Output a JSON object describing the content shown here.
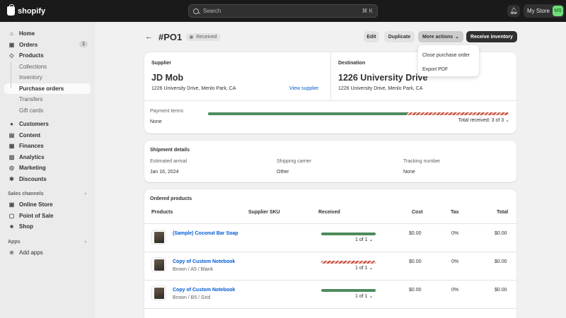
{
  "topbar": {
    "logo": "shopify",
    "search_placeholder": "Search",
    "search_shortcut": "⌘ K",
    "store_name": "My Store",
    "avatar_initials": "MS"
  },
  "sidebar": {
    "items": [
      {
        "label": "Home",
        "icon": "home-icon"
      },
      {
        "label": "Orders",
        "icon": "orders-icon",
        "badge": "1"
      },
      {
        "label": "Products",
        "icon": "tag-icon"
      }
    ],
    "product_sub": [
      "Collections",
      "Inventory",
      "Purchase orders",
      "Transfers",
      "Gift cards"
    ],
    "items2": [
      {
        "label": "Customers",
        "icon": "person-icon"
      },
      {
        "label": "Content",
        "icon": "content-icon"
      },
      {
        "label": "Finances",
        "icon": "bank-icon"
      },
      {
        "label": "Analytics",
        "icon": "chart-icon"
      },
      {
        "label": "Marketing",
        "icon": "target-icon"
      },
      {
        "label": "Discounts",
        "icon": "discount-icon"
      }
    ],
    "sales_channels_label": "Sales channels",
    "channels": [
      {
        "label": "Online Store",
        "icon": "store-icon"
      },
      {
        "label": "Point of Sale",
        "icon": "pos-icon"
      },
      {
        "label": "Shop",
        "icon": "shop-icon"
      }
    ],
    "apps_label": "Apps",
    "add_apps": "Add apps"
  },
  "header": {
    "title": "#PO1",
    "status": "Received",
    "edit": "Edit",
    "duplicate": "Duplicate",
    "more_actions": "More actions",
    "receive_inventory": "Receive inventory"
  },
  "dropdown": {
    "items": [
      "Close purchase order",
      "Export PDF"
    ]
  },
  "summary": {
    "supplier_label": "Supplier",
    "supplier_name": "JD Mob",
    "supplier_address": "1226 University Drive, Menlo Park, CA",
    "view_supplier": "View supplier",
    "destination_label": "Destination",
    "destination_name": "1226 University Drive",
    "destination_address": "1226 University Drive, Menlo Park, CA",
    "payment_terms_label": "Payment terms",
    "payment_terms_value": "None",
    "total_received": "Total received: 3 of 3",
    "received_fraction": 0.66
  },
  "shipment": {
    "title": "Shipment details",
    "arrival_label": "Estimated arrival",
    "arrival_value": "Jan 16, 2024",
    "carrier_label": "Shipping carrier",
    "carrier_value": "Other",
    "tracking_label": "Tracking number",
    "tracking_value": "None"
  },
  "ordered": {
    "title": "Ordered products",
    "columns": [
      "Products",
      "Supplier SKU",
      "Received",
      "Cost",
      "Tax",
      "Total"
    ],
    "rows": [
      {
        "name": "(Sample) Coconut Bar Soap",
        "variant": "",
        "received": "1 of 1",
        "fraction": 1,
        "cost": "$0.00",
        "tax": "0%",
        "total": "$0.00"
      },
      {
        "name": "Copy of Custom Notebook",
        "variant": "Brown / A5 / Blank",
        "received": "1 of 1",
        "fraction": 0,
        "cost": "$0.00",
        "tax": "0%",
        "total": "$0.00"
      },
      {
        "name": "Copy of Custom Notebook",
        "variant": "Brown / B5 / Grid",
        "received": "1 of 1",
        "fraction": 1,
        "cost": "$0.00",
        "tax": "0%",
        "total": "$0.00"
      }
    ]
  }
}
